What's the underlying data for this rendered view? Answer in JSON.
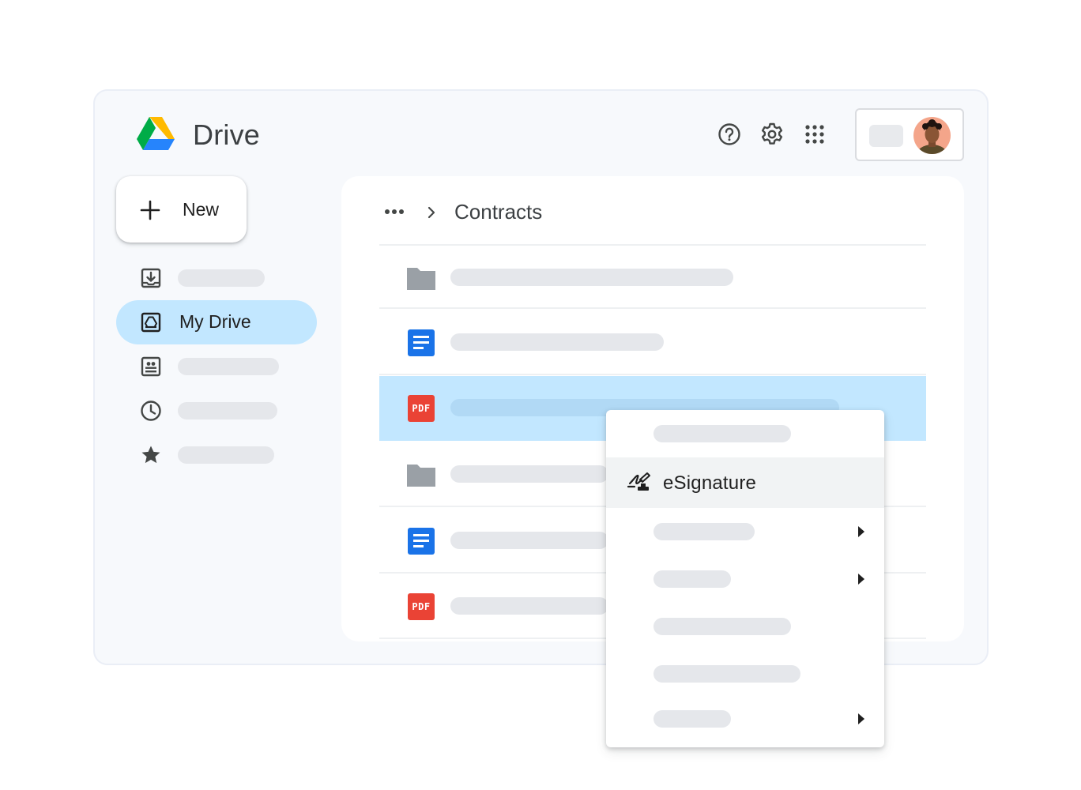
{
  "app": {
    "title": "Drive"
  },
  "header": {
    "icons": [
      "help-icon",
      "settings-gear-icon",
      "apps-grid-icon"
    ]
  },
  "new_button": {
    "label": "New"
  },
  "sidebar": {
    "items": [
      {
        "id": "priority",
        "icon": "inbox-download-icon",
        "label": ""
      },
      {
        "id": "my-drive",
        "icon": "my-drive-icon",
        "label": "My Drive",
        "active": true
      },
      {
        "id": "shared",
        "icon": "shared-drives-icon",
        "label": ""
      },
      {
        "id": "recent",
        "icon": "clock-icon",
        "label": ""
      },
      {
        "id": "starred",
        "icon": "star-icon",
        "label": ""
      }
    ]
  },
  "breadcrumb": {
    "current": "Contracts"
  },
  "files": [
    {
      "type": "folder"
    },
    {
      "type": "doc"
    },
    {
      "type": "pdf",
      "selected": true,
      "badge": "PDF"
    },
    {
      "type": "folder"
    },
    {
      "type": "doc"
    },
    {
      "type": "pdf",
      "badge": "PDF"
    }
  ],
  "context_menu": {
    "highlighted_label": "eSignature",
    "items": [
      {
        "label": "",
        "has_submenu": false
      },
      {
        "label": "eSignature",
        "has_submenu": false,
        "highlighted": true,
        "icon": "signature-icon"
      },
      {
        "label": "",
        "has_submenu": true
      },
      {
        "label": "",
        "has_submenu": true
      },
      {
        "label": "",
        "has_submenu": false
      },
      {
        "label": "",
        "has_submenu": false
      },
      {
        "label": "",
        "has_submenu": true
      }
    ]
  },
  "colors": {
    "accent_selection": "#c2e7ff",
    "doc_blue": "#1a73e8",
    "pdf_red": "#ea4335",
    "folder_gray": "#9aa0a6",
    "placeholder": "#e5e7eb"
  }
}
